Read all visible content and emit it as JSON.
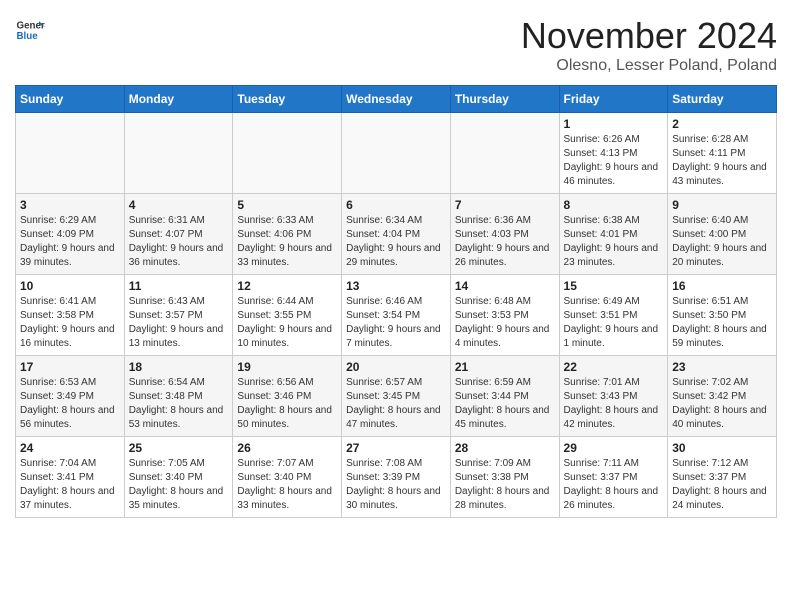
{
  "logo": {
    "general": "General",
    "blue": "Blue"
  },
  "title": "November 2024",
  "location": "Olesno, Lesser Poland, Poland",
  "weekdays": [
    "Sunday",
    "Monday",
    "Tuesday",
    "Wednesday",
    "Thursday",
    "Friday",
    "Saturday"
  ],
  "weeks": [
    [
      {
        "day": "",
        "info": ""
      },
      {
        "day": "",
        "info": ""
      },
      {
        "day": "",
        "info": ""
      },
      {
        "day": "",
        "info": ""
      },
      {
        "day": "",
        "info": ""
      },
      {
        "day": "1",
        "info": "Sunrise: 6:26 AM\nSunset: 4:13 PM\nDaylight: 9 hours and 46 minutes."
      },
      {
        "day": "2",
        "info": "Sunrise: 6:28 AM\nSunset: 4:11 PM\nDaylight: 9 hours and 43 minutes."
      }
    ],
    [
      {
        "day": "3",
        "info": "Sunrise: 6:29 AM\nSunset: 4:09 PM\nDaylight: 9 hours and 39 minutes."
      },
      {
        "day": "4",
        "info": "Sunrise: 6:31 AM\nSunset: 4:07 PM\nDaylight: 9 hours and 36 minutes."
      },
      {
        "day": "5",
        "info": "Sunrise: 6:33 AM\nSunset: 4:06 PM\nDaylight: 9 hours and 33 minutes."
      },
      {
        "day": "6",
        "info": "Sunrise: 6:34 AM\nSunset: 4:04 PM\nDaylight: 9 hours and 29 minutes."
      },
      {
        "day": "7",
        "info": "Sunrise: 6:36 AM\nSunset: 4:03 PM\nDaylight: 9 hours and 26 minutes."
      },
      {
        "day": "8",
        "info": "Sunrise: 6:38 AM\nSunset: 4:01 PM\nDaylight: 9 hours and 23 minutes."
      },
      {
        "day": "9",
        "info": "Sunrise: 6:40 AM\nSunset: 4:00 PM\nDaylight: 9 hours and 20 minutes."
      }
    ],
    [
      {
        "day": "10",
        "info": "Sunrise: 6:41 AM\nSunset: 3:58 PM\nDaylight: 9 hours and 16 minutes."
      },
      {
        "day": "11",
        "info": "Sunrise: 6:43 AM\nSunset: 3:57 PM\nDaylight: 9 hours and 13 minutes."
      },
      {
        "day": "12",
        "info": "Sunrise: 6:44 AM\nSunset: 3:55 PM\nDaylight: 9 hours and 10 minutes."
      },
      {
        "day": "13",
        "info": "Sunrise: 6:46 AM\nSunset: 3:54 PM\nDaylight: 9 hours and 7 minutes."
      },
      {
        "day": "14",
        "info": "Sunrise: 6:48 AM\nSunset: 3:53 PM\nDaylight: 9 hours and 4 minutes."
      },
      {
        "day": "15",
        "info": "Sunrise: 6:49 AM\nSunset: 3:51 PM\nDaylight: 9 hours and 1 minute."
      },
      {
        "day": "16",
        "info": "Sunrise: 6:51 AM\nSunset: 3:50 PM\nDaylight: 8 hours and 59 minutes."
      }
    ],
    [
      {
        "day": "17",
        "info": "Sunrise: 6:53 AM\nSunset: 3:49 PM\nDaylight: 8 hours and 56 minutes."
      },
      {
        "day": "18",
        "info": "Sunrise: 6:54 AM\nSunset: 3:48 PM\nDaylight: 8 hours and 53 minutes."
      },
      {
        "day": "19",
        "info": "Sunrise: 6:56 AM\nSunset: 3:46 PM\nDaylight: 8 hours and 50 minutes."
      },
      {
        "day": "20",
        "info": "Sunrise: 6:57 AM\nSunset: 3:45 PM\nDaylight: 8 hours and 47 minutes."
      },
      {
        "day": "21",
        "info": "Sunrise: 6:59 AM\nSunset: 3:44 PM\nDaylight: 8 hours and 45 minutes."
      },
      {
        "day": "22",
        "info": "Sunrise: 7:01 AM\nSunset: 3:43 PM\nDaylight: 8 hours and 42 minutes."
      },
      {
        "day": "23",
        "info": "Sunrise: 7:02 AM\nSunset: 3:42 PM\nDaylight: 8 hours and 40 minutes."
      }
    ],
    [
      {
        "day": "24",
        "info": "Sunrise: 7:04 AM\nSunset: 3:41 PM\nDaylight: 8 hours and 37 minutes."
      },
      {
        "day": "25",
        "info": "Sunrise: 7:05 AM\nSunset: 3:40 PM\nDaylight: 8 hours and 35 minutes."
      },
      {
        "day": "26",
        "info": "Sunrise: 7:07 AM\nSunset: 3:40 PM\nDaylight: 8 hours and 33 minutes."
      },
      {
        "day": "27",
        "info": "Sunrise: 7:08 AM\nSunset: 3:39 PM\nDaylight: 8 hours and 30 minutes."
      },
      {
        "day": "28",
        "info": "Sunrise: 7:09 AM\nSunset: 3:38 PM\nDaylight: 8 hours and 28 minutes."
      },
      {
        "day": "29",
        "info": "Sunrise: 7:11 AM\nSunset: 3:37 PM\nDaylight: 8 hours and 26 minutes."
      },
      {
        "day": "30",
        "info": "Sunrise: 7:12 AM\nSunset: 3:37 PM\nDaylight: 8 hours and 24 minutes."
      }
    ]
  ]
}
